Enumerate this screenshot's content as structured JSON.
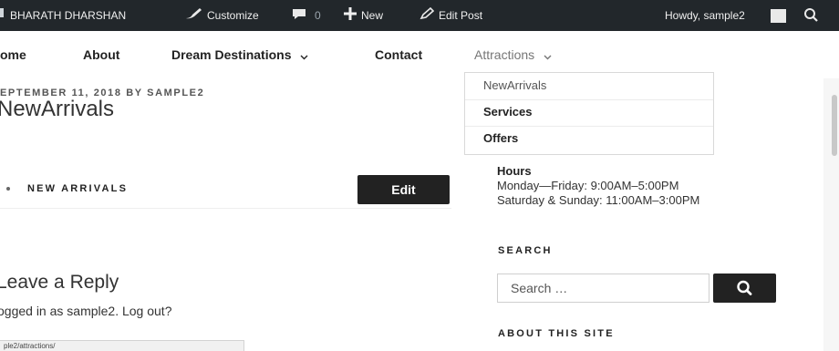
{
  "admin_bar": {
    "site_name": "BHARATH DHARSHAN",
    "customize_label": "Customize",
    "comments_count": "0",
    "new_label": "New",
    "edit_post_label": "Edit Post",
    "howdy_text": "Howdy, sample2",
    "icons": [
      "wordpress-logo-icon",
      "paintbrush-icon",
      "comment-icon",
      "plus-icon",
      "pencil-icon",
      "avatar",
      "search-icon"
    ]
  },
  "nav": {
    "items": [
      {
        "label": "ome"
      },
      {
        "label": "About"
      },
      {
        "label": "Dream Destinations",
        "has_submenu": true
      },
      {
        "label": "Contact"
      },
      {
        "label": "Attractions",
        "has_submenu": true
      }
    ],
    "dropdown": [
      {
        "label": "NewArrivals"
      },
      {
        "label": "Services"
      },
      {
        "label": "Offers"
      }
    ]
  },
  "post": {
    "meta": "EPTEMBER 11, 2018 BY SAMPLE2",
    "title": "NewArrivals",
    "link_label": "NEW ARRIVALS",
    "edit_label": "Edit",
    "reply_title": "Leave a Reply",
    "logged_in_text": "ogged in as sample2. Log out?",
    "status_url": "ple2/attractions/"
  },
  "sidebar": {
    "hours_heading": "Hours",
    "hours_weekdays": "Monday—Friday: 9:00AM–5:00PM",
    "hours_weekend": "Saturday & Sunday: 11:00AM–3:00PM",
    "search_heading": "SEARCH",
    "search_placeholder": "Search …",
    "about_heading": "ABOUT THIS SITE"
  },
  "colors": {
    "admin_bar_bg": "#22272b",
    "button_bg": "#222222",
    "accent_text": "#767676"
  }
}
